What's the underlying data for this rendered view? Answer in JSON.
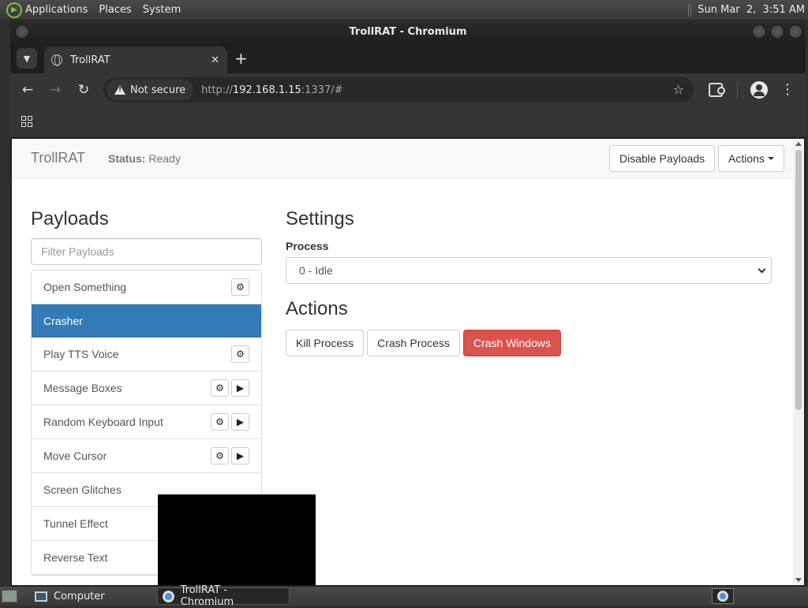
{
  "desktop": {
    "menus": [
      "Applications",
      "Places",
      "System"
    ],
    "clock": "Sun Mar  2,  3:51 AM"
  },
  "window": {
    "title": "TrollRAT - Chromium"
  },
  "browser": {
    "tab_title": "TrollRAT",
    "tab_close": "✕",
    "new_tab": "+",
    "security_label": "Not secure",
    "url_scheme": "http://",
    "url_host": "192.168.1.15",
    "url_rest": ":1337/#"
  },
  "app": {
    "brand": "TrollRAT",
    "status_label": "Status:",
    "status_value": "Ready",
    "disable_button": "Disable Payloads",
    "actions_menu": "Actions",
    "payloads_heading": "Payloads",
    "filter_placeholder": "Filter Payloads",
    "payloads": [
      {
        "name": "Open Something",
        "settings": true,
        "play": false,
        "active": false
      },
      {
        "name": "Crasher",
        "settings": false,
        "play": false,
        "active": true
      },
      {
        "name": "Play TTS Voice",
        "settings": true,
        "play": false,
        "active": false
      },
      {
        "name": "Message Boxes",
        "settings": true,
        "play": true,
        "active": false
      },
      {
        "name": "Random Keyboard Input",
        "settings": true,
        "play": true,
        "active": false
      },
      {
        "name": "Move Cursor",
        "settings": true,
        "play": true,
        "active": false
      },
      {
        "name": "Screen Glitches",
        "settings": false,
        "play": false,
        "active": false
      },
      {
        "name": "Tunnel Effect",
        "settings": false,
        "play": false,
        "active": false
      },
      {
        "name": "Reverse Text",
        "settings": false,
        "play": false,
        "active": false
      }
    ],
    "settings_heading": "Settings",
    "process_label": "Process",
    "process_selected": "0 - Idle",
    "actions_heading": "Actions",
    "action_buttons": [
      "Kill Process",
      "Crash Process",
      "Crash Windows"
    ]
  },
  "taskbar": {
    "tasks": [
      "Computer",
      "TrollRAT - Chromium"
    ]
  },
  "colors": {
    "primary": "#337ab7",
    "danger": "#d9534f"
  }
}
